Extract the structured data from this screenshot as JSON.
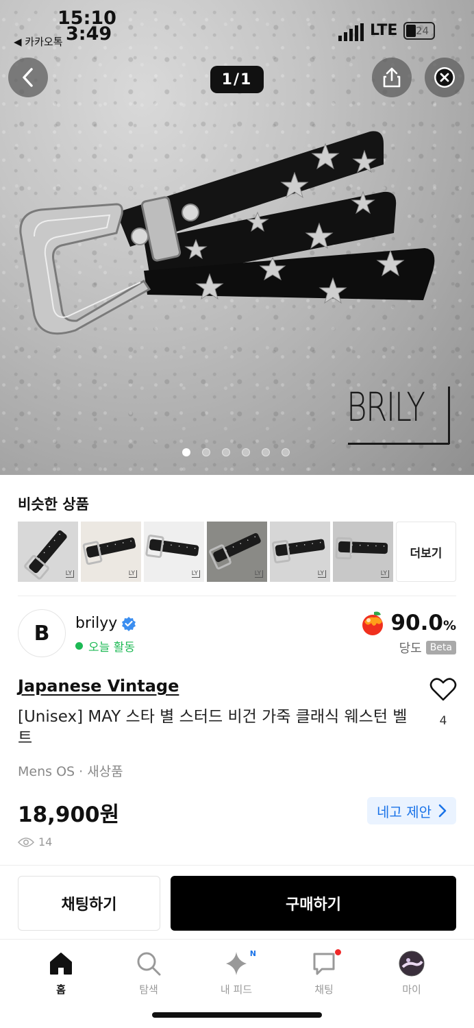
{
  "status_bar": {
    "time": "15:10",
    "time_overlay": "3:49",
    "back_app": "◀ 카카오톡",
    "network": "LTE",
    "battery": "24"
  },
  "gallery": {
    "indicator": "1/1",
    "brand_text": "BRILY",
    "dot_count": 6,
    "active_dot": 0
  },
  "similar": {
    "title": "비슷한 상품",
    "more_label": "더보기",
    "thumbs": [
      "LY",
      "LY",
      "LY",
      "LY",
      "LY",
      "LY"
    ],
    "thumb_backgrounds": [
      "#d8d8d8",
      "#ece8e2",
      "#efefef",
      "#8a8a86",
      "#d6d6d6",
      "#c8c8c8"
    ]
  },
  "seller": {
    "avatar_letter": "B",
    "name": "brilyy",
    "activity": "오늘 활동",
    "rating": "90.0",
    "rating_unit": "%",
    "rating_label": "당도",
    "beta": "Beta"
  },
  "product": {
    "brand": "Japanese Vintage",
    "title": "[Unisex] MAY 스타 별 스터드 비건 가죽 클래식 웨스턴 벨트",
    "likes": "4",
    "meta": "Mens OS · 새상품",
    "price": "18,900원",
    "offer_label": "네고 제안",
    "views": "14"
  },
  "actions": {
    "chat": "채팅하기",
    "buy": "구매하기"
  },
  "tabs": [
    {
      "label": "홈",
      "active": true
    },
    {
      "label": "탐색",
      "active": false
    },
    {
      "label": "내 피드",
      "active": false,
      "badge": "N"
    },
    {
      "label": "채팅",
      "active": false,
      "dot": true
    },
    {
      "label": "마이",
      "active": false
    }
  ],
  "colors": {
    "accent_blue": "#1a73e8",
    "online_green": "#1db954",
    "notification_red": "#f02828"
  }
}
